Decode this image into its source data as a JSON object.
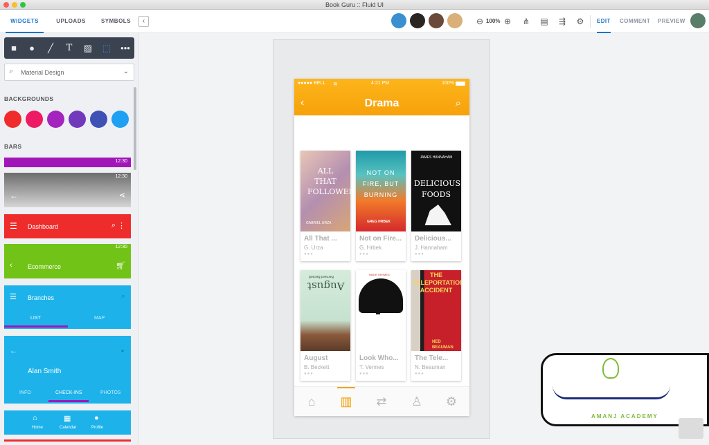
{
  "window": {
    "title": "Book Guru :: Fluid UI"
  },
  "toolbar": {
    "tabs": [
      "WIDGETS",
      "UPLOADS",
      "SYMBOLS"
    ],
    "collapse_icon": "chevron-left-icon",
    "zoom": "100%",
    "mode_tabs": [
      "EDIT",
      "COMMENT",
      "PREVIEW"
    ]
  },
  "sidebar": {
    "search_value": "Material Design",
    "backgrounds_title": "BACKGROUNDS",
    "background_colors": [
      "#f02b2b",
      "#ee1a63",
      "#a425be",
      "#7239bd",
      "#3f51b5",
      "#1fa0f2"
    ],
    "bars_title": "BARS",
    "bar1_time": "12:30",
    "bar2_time": "12:30",
    "dashboard_label": "Dashboard",
    "bar4_time": "12:30",
    "ecommerce_label": "Ecommerce",
    "branches_label": "Branches",
    "branches_tabs": [
      "LIST",
      "MAP"
    ],
    "profile_name": "Alan Smith",
    "profile_tabs": [
      "INFO",
      "CHECK-INS",
      "PHOTOS"
    ],
    "bottom_items": [
      "Home",
      "Calendar",
      "Profile"
    ]
  },
  "phone": {
    "carrier": "●●●●● BELL",
    "time": "4:21 PM",
    "battery": "100%",
    "title": "Drama",
    "books": [
      {
        "title": "All That ...",
        "author": "G. Urza",
        "cover_text": "ALL THAT FOLLOWED",
        "cover_sub": "GABRIEL URZA",
        "color": "#d9a8a0"
      },
      {
        "title": "Not on Fire...",
        "author": "G. Hrbek",
        "cover_text": "NOT ON FIRE, BUT BURNING",
        "cover_sub": "GREG HRBEK",
        "color": "#1f9aa8"
      },
      {
        "title": "Delicious...",
        "author": "J. Hannaham",
        "cover_text": "DELICIOUS FOODS",
        "cover_sub": "JAMES HANNAHAM",
        "color": "#111111"
      },
      {
        "title": "August",
        "author": "B. Beckett",
        "cover_text": "August",
        "cover_sub": "Bernard Beckett",
        "color": "#cfe6d6"
      },
      {
        "title": "Look Who...",
        "author": "T. Vermes",
        "cover_text": "",
        "cover_sub": "TIMUR VERMES",
        "color": "#ffffff"
      },
      {
        "title": "The Tele...",
        "author": "N. Beauman",
        "cover_text": "THE TELEPORTATION ACCIDENT",
        "cover_sub": "NED BEAUMAN",
        "color": "#c8202b"
      }
    ]
  },
  "watermark": {
    "sub": "AMANJ ACADEMY"
  }
}
